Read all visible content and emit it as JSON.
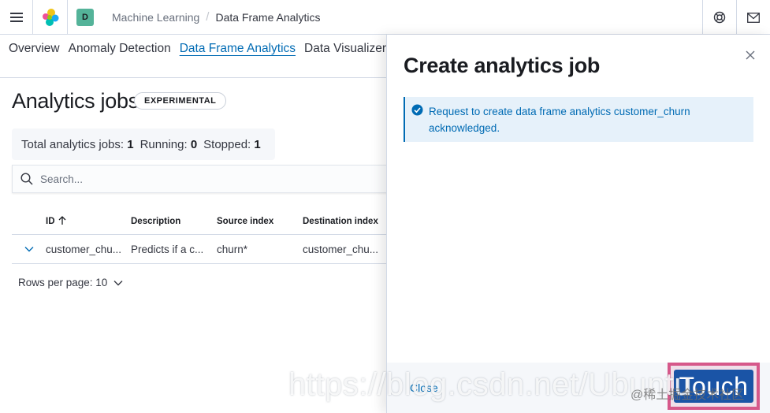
{
  "header": {
    "space_initial": "D",
    "breadcrumbs": [
      "Machine Learning",
      "Data Frame Analytics"
    ],
    "icons": [
      "menu-icon",
      "elastic-logo",
      "help-icon",
      "mail-icon"
    ]
  },
  "nav": {
    "tabs": [
      "Overview",
      "Anomaly Detection",
      "Data Frame Analytics",
      "Data Visualizer"
    ],
    "active_tab": "Data Frame Analytics"
  },
  "page": {
    "title": "Analytics jobs",
    "badge": "EXPERIMENTAL",
    "stats": {
      "total_label": "Total analytics jobs:",
      "total_value": "1",
      "running_label": "Running:",
      "running_value": "0",
      "stopped_label": "Stopped:",
      "stopped_value": "1"
    },
    "search_placeholder": "Search..."
  },
  "table": {
    "columns": [
      "ID",
      "Description",
      "Source index",
      "Destination index"
    ],
    "sorted_column": "ID",
    "rows": [
      {
        "id": "customer_chu...",
        "description": "Predicts if a c...",
        "source_index": "churn*",
        "destination_index": "customer_chu..."
      }
    ],
    "rows_per_page_label": "Rows per page: 10"
  },
  "flyout": {
    "title": "Create analytics job",
    "callout_text": "Request to create data frame analytics customer_churn acknowledged.",
    "footer_close_label": "Close",
    "footer_button_label": "Touch"
  },
  "watermark": {
    "url": "https://blog.csdn.net/Ubuntu",
    "cn": "@稀土掘金技术社区"
  },
  "colors": {
    "accent": "#006bb4",
    "space_badge": "#54b399",
    "callout_bg": "#e6f1fa",
    "highlight": "#d6588a",
    "button": "#1a54a6"
  }
}
